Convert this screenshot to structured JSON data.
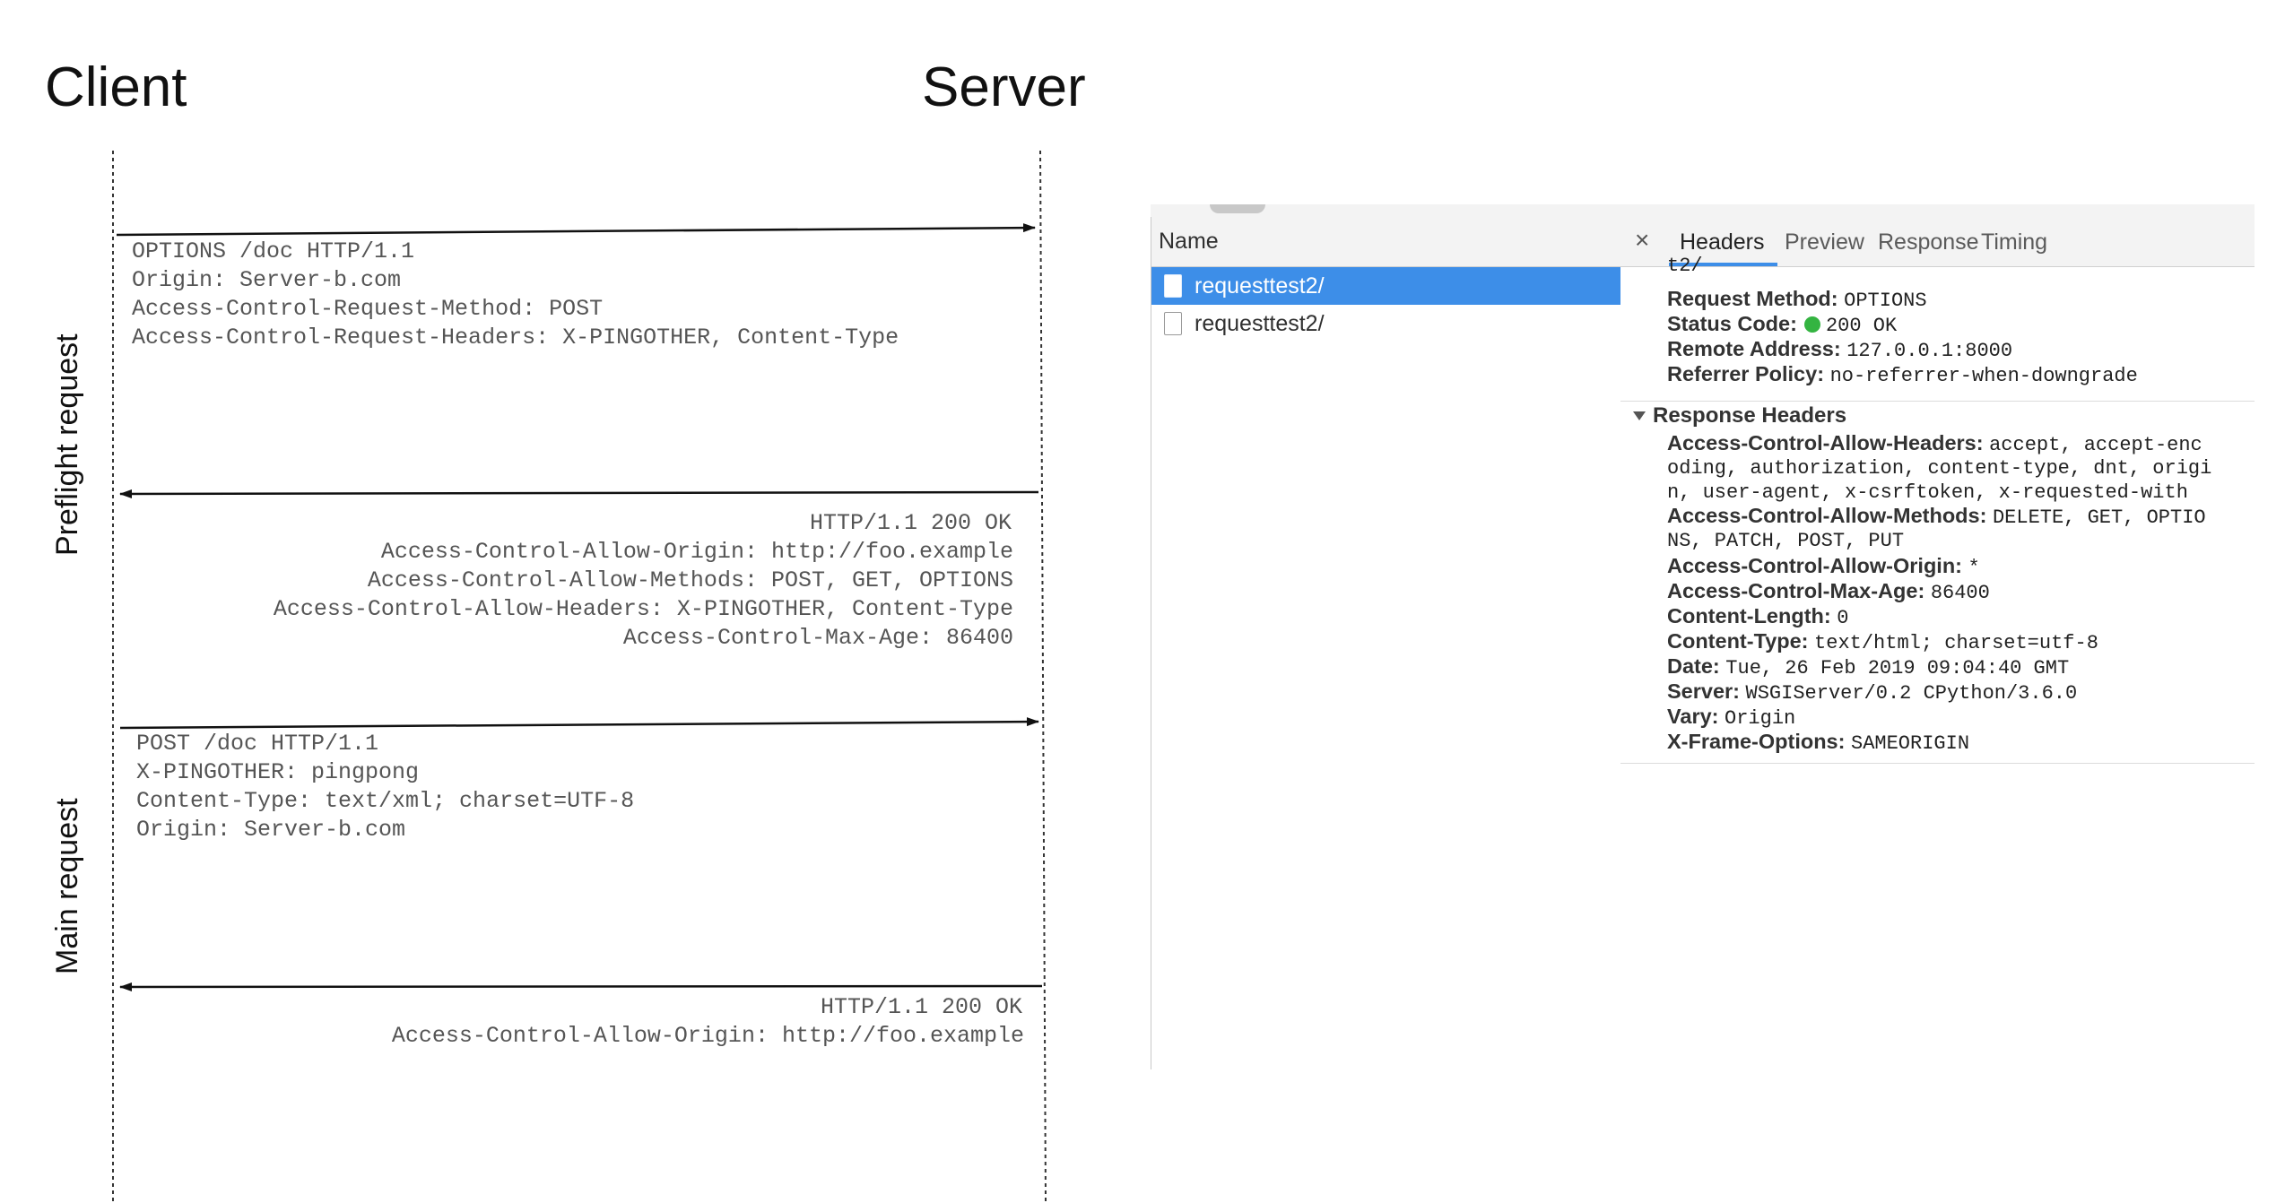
{
  "diagram": {
    "client_label": "Client",
    "server_label": "Server",
    "preflight_label": "Preflight request",
    "main_label": "Main request",
    "preflight_request_lines": [
      "OPTIONS /doc HTTP/1.1",
      "Origin: Server-b.com",
      "Access-Control-Request-Method: POST",
      "Access-Control-Request-Headers: X-PINGOTHER, Content-Type"
    ],
    "preflight_response_lines": [
      "HTTP/1.1 200 OK",
      "Access-Control-Allow-Origin: http://foo.example",
      "Access-Control-Allow-Methods: POST, GET, OPTIONS",
      "Access-Control-Allow-Headers: X-PINGOTHER, Content-Type",
      "Access-Control-Max-Age: 86400"
    ],
    "main_request_lines": [
      "POST /doc HTTP/1.1",
      "X-PINGOTHER: pingpong",
      "Content-Type: text/xml; charset=UTF-8",
      "Origin: Server-b.com"
    ],
    "main_response_lines": [
      "HTTP/1.1 200 OK",
      "Access-Control-Allow-Origin: http://foo.example"
    ]
  },
  "devtools": {
    "name_header": "Name",
    "requests": [
      "requesttest2/",
      "requesttest2/"
    ],
    "close_icon": "close-icon",
    "tabs": [
      "Headers",
      "Preview",
      "Response",
      "Timing"
    ],
    "cut_text": "t2/",
    "general": {
      "request_method_key": "Request Method:",
      "request_method_value": "OPTIONS",
      "status_code_key": "Status Code:",
      "status_code_value": "200 OK",
      "status_color": "#34b441",
      "remote_address_key": "Remote Address:",
      "remote_address_value": "127.0.0.1:8000",
      "referrer_policy_key": "Referrer Policy:",
      "referrer_policy_value": "no-referrer-when-downgrade"
    },
    "response_headers_title": "Response Headers",
    "rh": {
      "allow_headers_key": "Access-Control-Allow-Headers:",
      "allow_headers_l1": "accept, accept-enc",
      "allow_headers_l2": "oding, authorization, content-type, dnt, origi",
      "allow_headers_l3": "n, user-agent, x-csrftoken, x-requested-with",
      "allow_methods_key": "Access-Control-Allow-Methods:",
      "allow_methods_l1": "DELETE, GET, OPTIO",
      "allow_methods_l2": "NS, PATCH, POST, PUT",
      "allow_origin_key": "Access-Control-Allow-Origin:",
      "allow_origin_value": "*",
      "max_age_key": "Access-Control-Max-Age:",
      "max_age_value": "86400",
      "content_length_key": "Content-Length:",
      "content_length_value": "0",
      "content_type_key": "Content-Type:",
      "content_type_value": "text/html; charset=utf-8",
      "date_key": "Date:",
      "date_value": "Tue, 26 Feb 2019 09:04:40 GMT",
      "server_key": "Server:",
      "server_value": "WSGIServer/0.2 CPython/3.6.0",
      "vary_key": "Vary:",
      "vary_value": "Origin",
      "xframe_key": "X-Frame-Options:",
      "xframe_value": "SAMEORIGIN"
    },
    "accent_color": "#3d8ee8"
  }
}
